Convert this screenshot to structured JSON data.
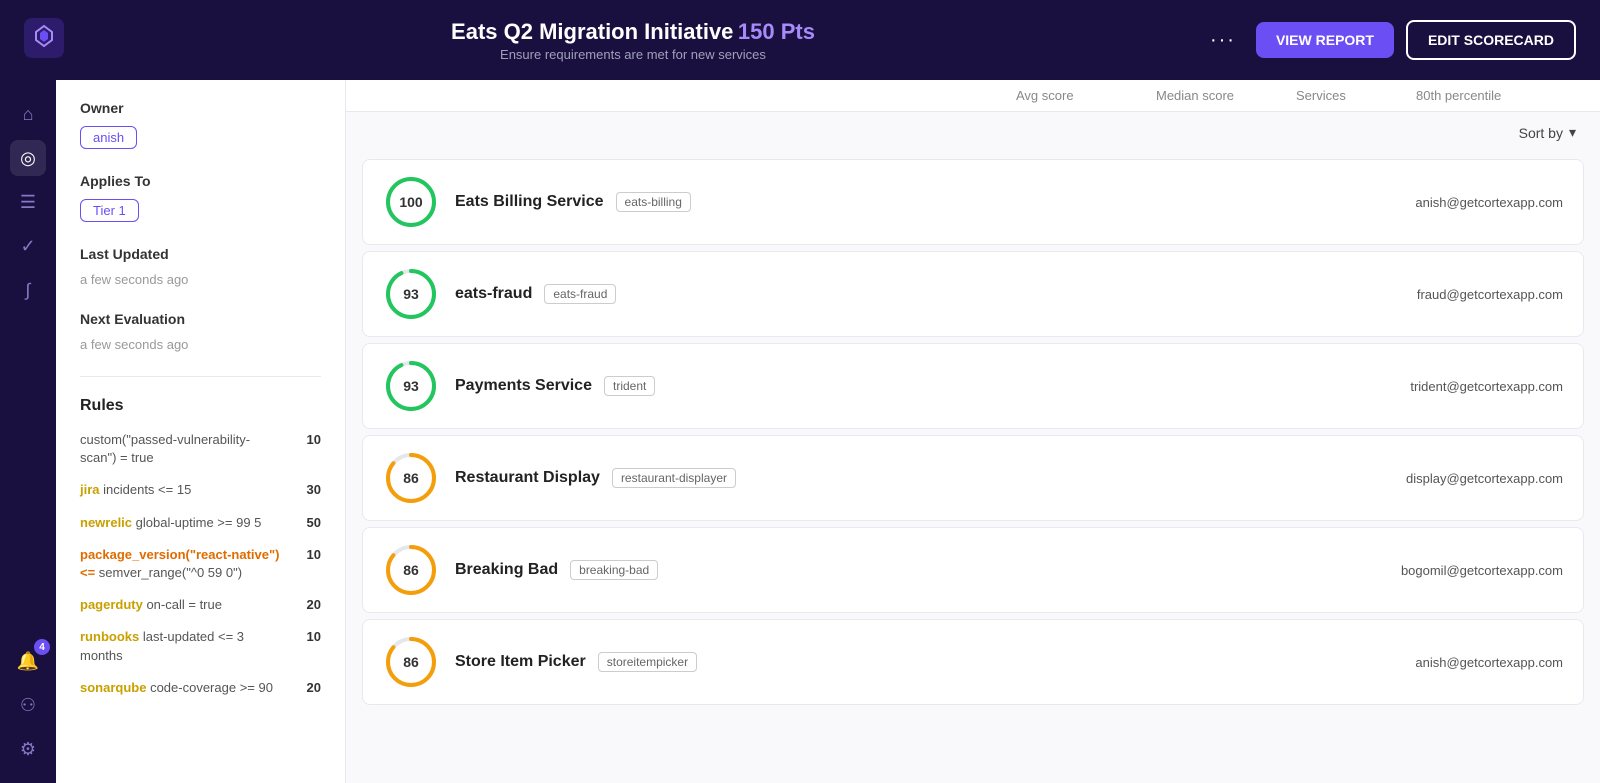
{
  "header": {
    "title": "Eats Q2 Migration Initiative",
    "pts": "150 Pts",
    "subtitle": "Ensure requirements are met for new services",
    "dots_label": "···",
    "view_report_label": "VIEW REPORT",
    "edit_scorecard_label": "EDIT SCORECARD"
  },
  "nav": {
    "items": [
      {
        "name": "home",
        "icon": "⌂",
        "active": false
      },
      {
        "name": "scorecard",
        "icon": "◎",
        "active": true
      },
      {
        "name": "list",
        "icon": "☰",
        "active": false
      },
      {
        "name": "check",
        "icon": "✓",
        "active": false
      },
      {
        "name": "wave",
        "icon": "∫",
        "active": false
      }
    ],
    "bottom_items": [
      {
        "name": "badge",
        "icon": "4",
        "badge": true,
        "count": "4"
      },
      {
        "name": "team",
        "icon": "⚇",
        "active": false
      },
      {
        "name": "settings",
        "icon": "⚙",
        "active": false
      }
    ]
  },
  "left_panel": {
    "owner_label": "Owner",
    "owner_value": "anish",
    "applies_to_label": "Applies To",
    "applies_to_value": "Tier 1",
    "last_updated_label": "Last Updated",
    "last_updated_value": "a few seconds ago",
    "next_eval_label": "Next Evaluation",
    "next_eval_value": "a few seconds ago",
    "rules_title": "Rules",
    "rules": [
      {
        "text": "custom(\"passed-vulnerability-scan\") = true",
        "highlight": null,
        "points": "10"
      },
      {
        "text": " incidents <= 15",
        "highlight": "jira",
        "points": "30"
      },
      {
        "text": " global-uptime >= 99 5",
        "highlight": "newrelic",
        "points": "50"
      },
      {
        "text": " semver_range(\"^0 59 0\")",
        "highlight_text": "package_version(\"react-native\") <=",
        "highlight": "package_version",
        "points": "10"
      },
      {
        "text": " on-call = true",
        "highlight": "pagerduty",
        "points": "20"
      },
      {
        "text": " last-updated <= 3 months",
        "highlight": "runbooks",
        "points": "10"
      },
      {
        "text": " code-coverage >= 90",
        "highlight": "sonarqube",
        "points": "20"
      }
    ]
  },
  "col_headers": {
    "avg_score": "Avg score",
    "median_score": "Median score",
    "services": "Services",
    "percentile": "80th percentile"
  },
  "sort_by_label": "Sort by",
  "services": [
    {
      "name": "Eats Billing Service",
      "tag": "eats-billing",
      "score": 100,
      "color": "#22c55e",
      "email": "anish@getcortexapp.com",
      "circle_dash": 100
    },
    {
      "name": "eats-fraud",
      "tag": "eats-fraud",
      "score": 93,
      "color": "#22c55e",
      "email": "fraud@getcortexapp.com",
      "circle_dash": 93
    },
    {
      "name": "Payments Service",
      "tag": "trident",
      "score": 93,
      "color": "#22c55e",
      "email": "trident@getcortexapp.com",
      "circle_dash": 93
    },
    {
      "name": "Restaurant Display",
      "tag": "restaurant-displayer",
      "score": 86,
      "color": "#f59e0b",
      "email": "display@getcortexapp.com",
      "circle_dash": 86
    },
    {
      "name": "Breaking Bad",
      "tag": "breaking-bad",
      "score": 86,
      "color": "#f59e0b",
      "email": "bogomil@getcortexapp.com",
      "circle_dash": 86
    },
    {
      "name": "Store Item Picker",
      "tag": "storeitempicker",
      "score": 86,
      "color": "#f59e0b",
      "email": "anish@getcortexapp.com",
      "circle_dash": 86
    }
  ]
}
